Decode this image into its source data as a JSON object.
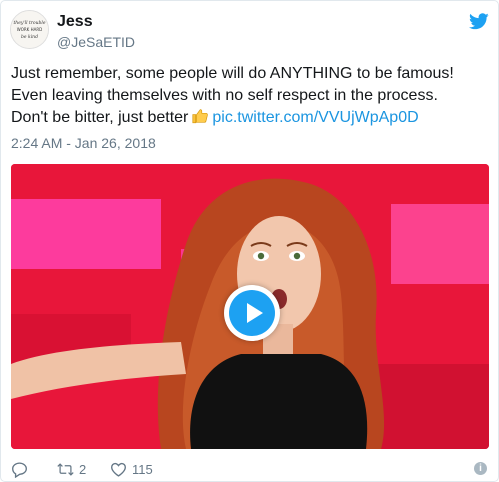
{
  "user": {
    "name": "Jess",
    "handle": "@JeSaETID",
    "avatar_text": [
      "they'll trouble",
      "WORK HARD",
      "be kind"
    ]
  },
  "tweet": {
    "lines": [
      "Just remember, some people will do ANYTHING to be famous!",
      "Even leaving themselves with no self respect in the process.",
      "Don't be bitter, just better"
    ],
    "link": "pic.twitter.com/VVUjWpAp0D",
    "emoji": "thumbs-up-icon",
    "timestamp": "2:24 AM - Jan 26, 2018"
  },
  "media": {
    "type": "video",
    "play_icon": "play-icon",
    "background_color": "#e8163a"
  },
  "actions": {
    "reply_icon": "reply-icon",
    "retweet_count": "2",
    "like_count": "115",
    "info_icon": "info-icon"
  },
  "colors": {
    "link": "#1b95e0",
    "brand": "#1da1f2",
    "muted": "#657786"
  }
}
